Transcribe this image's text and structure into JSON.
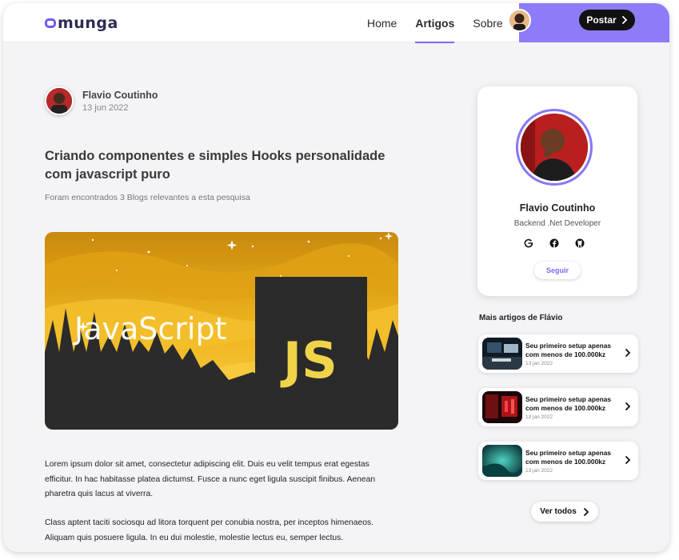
{
  "header": {
    "logo": "munga",
    "nav": [
      {
        "label": "Home",
        "active": false
      },
      {
        "label": "Artigos",
        "active": true
      },
      {
        "label": "Sobre",
        "active": false
      }
    ],
    "post_button": "Postar",
    "accent_color": "#8d7cf7"
  },
  "article": {
    "author_name": "Flavio Coutinho",
    "date": "13 jun 2022",
    "title": "Criando componentes e simples Hooks personalidade com javascript puro",
    "subtitle": "Foram encontrados 3 Blogs relevantes a esta pesquisa",
    "hero_text": "JavaScript",
    "hero_badge": "JS",
    "paragraphs": [
      "Lorem ipsum dolor sit amet, consectetur adipiscing elit. Duis eu velit tempus erat egestas efficitur. In hac habitasse platea dictumst. Fusce a nunc eget ligula suscipit finibus. Aenean pharetra quis lacus at viverra.",
      "Class aptent taciti sociosqu ad litora torquent per conubia nostra, per inceptos himenaeos. Aliquam quis posuere ligula. In eu dui molestie, molestie lectus eu, semper lectus."
    ]
  },
  "profile": {
    "name": "Flavio Coutinho",
    "role": "Backend .Net Developer",
    "socials": [
      "google-icon",
      "facebook-icon",
      "github-icon"
    ],
    "follow_button": "Seguir"
  },
  "more_articles": {
    "heading": "Mais artigos de Flávio",
    "items": [
      {
        "title": "Seu primeiro setup apenas com menos de 100.000kz",
        "date": "13 jan 2022",
        "thumb": "desk"
      },
      {
        "title": "Seu primeiro setup apenas com menos de 100.000kz",
        "date": "13 jan 2022",
        "thumb": "red"
      },
      {
        "title": "Seu primeiro setup apenas com menos de 100.000kz",
        "date": "13 jan 2022",
        "thumb": "teal"
      }
    ],
    "see_all": "Ver todos"
  }
}
